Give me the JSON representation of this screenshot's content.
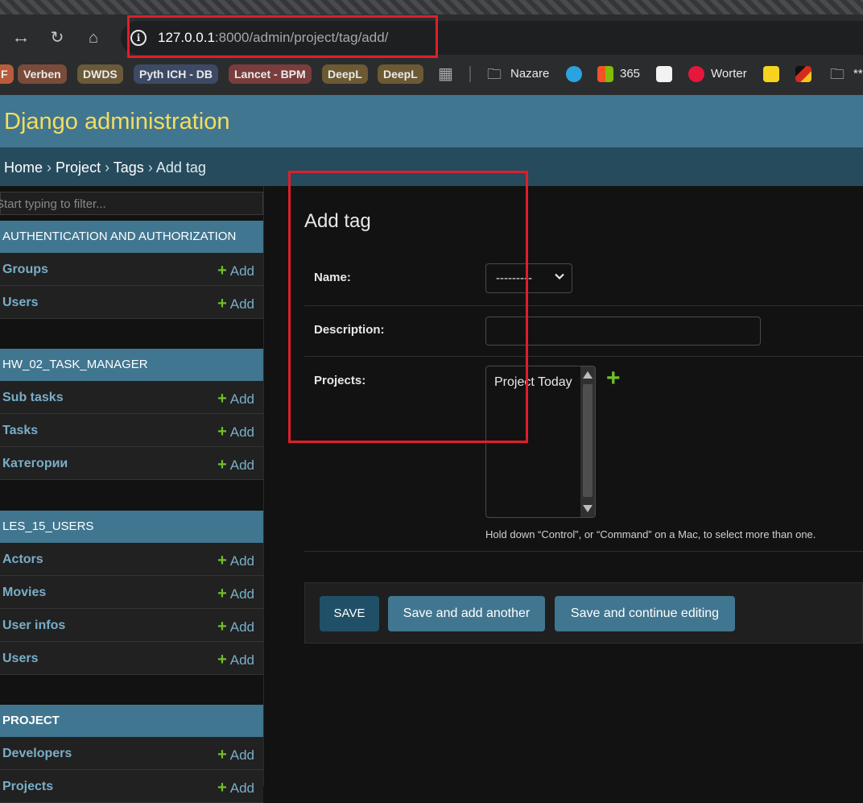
{
  "browser": {
    "url_host": "127.0.0.1",
    "url_rest": ":8000/admin/project/tag/add/",
    "bookmarks": [
      {
        "label": "F",
        "color": "#b85c3c"
      },
      {
        "label": "Verben",
        "color": "#7a4b3a"
      },
      {
        "label": "DWDS",
        "color": "#6b5a3a"
      },
      {
        "label": "Pyth ICH - DB",
        "color": "#3d4a66"
      },
      {
        "label": "Lancet - BPM",
        "color": "#7a3d3d"
      },
      {
        "label": "DeepL",
        "color": "#6b5a34"
      },
      {
        "label": "DeepL",
        "color": "#6b5a34"
      }
    ],
    "bookmark_links": [
      "Nazare",
      "365",
      "Worter",
      "**"
    ]
  },
  "site": {
    "title": "Django administration"
  },
  "breadcrumbs": {
    "home": "Home",
    "app": "Project",
    "model": "Tags",
    "current": "Add tag",
    "separator": "›"
  },
  "sidebar": {
    "filter_placeholder": "Start typing to filter...",
    "add_label": "Add",
    "apps": [
      {
        "caption": "AUTHENTICATION AND AUTHORIZATION",
        "models": [
          "Groups",
          "Users"
        ]
      },
      {
        "caption": "HW_02_TASK_MANAGER",
        "models": [
          "Sub tasks",
          "Tasks",
          "Категории"
        ]
      },
      {
        "caption": "LES_15_USERS",
        "models": [
          "Actors",
          "Movies",
          "User infos",
          "Users"
        ]
      },
      {
        "caption": "PROJECT",
        "models": [
          "Developers",
          "Projects"
        ]
      }
    ]
  },
  "form": {
    "heading": "Add tag",
    "name_label": "Name:",
    "name_value": "---------",
    "description_label": "Description:",
    "description_value": "",
    "projects_label": "Projects:",
    "projects_options": [
      "Project Today"
    ],
    "projects_help": "Hold down “Control”, or “Command” on a Mac, to select more than one."
  },
  "actions": {
    "save": "SAVE",
    "save_add_another": "Save and add another",
    "save_continue": "Save and continue editing"
  },
  "colors": {
    "header": "#417690",
    "breadcrumbs": "#264b5d",
    "title": "#f5dd5d",
    "link": "#79aec8",
    "add_green": "#70bf2b",
    "annotation_red": "#e01e2b"
  }
}
